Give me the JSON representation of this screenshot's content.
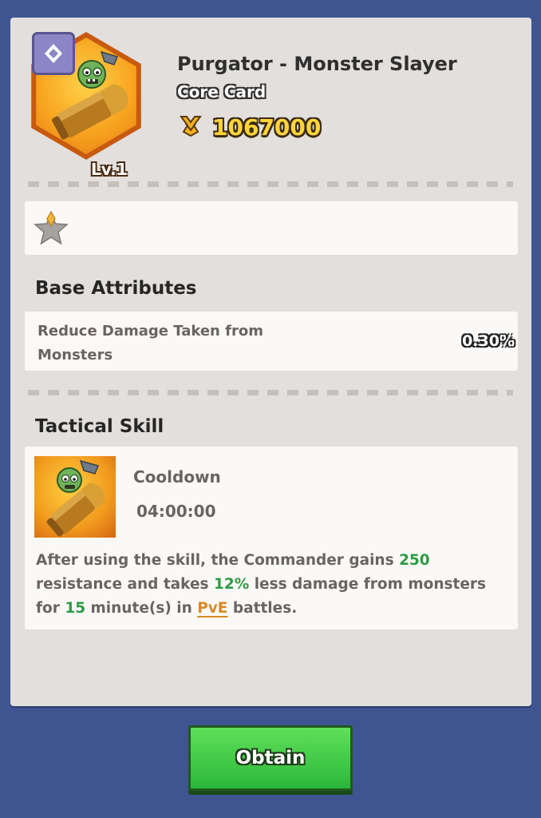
{
  "card": {
    "name": "Purgator - Monster Slayer",
    "type": "Core Card",
    "level": "Lv.1",
    "power": "1067000",
    "power_icon": "crossed-swords-shield-icon",
    "rarity_icon": "diamond-badge-icon",
    "stars": {
      "filled": 0,
      "total": 1
    }
  },
  "base_attributes": {
    "title": "Base Attributes",
    "items": [
      {
        "name": "Reduce Damage Taken from Monsters",
        "value": "0.30%"
      }
    ]
  },
  "tactical_skill": {
    "title": "Tactical Skill",
    "cooldown_label": "Cooldown",
    "cooldown_value": "04:00:00",
    "desc": {
      "p1": "After using the skill, the Commander gains ",
      "v1": "250",
      "p2": " resistance and takes ",
      "v2": "12%",
      "p3": " less damage from monsters for ",
      "v3": "15",
      "p4": " minute(s) in ",
      "link": "PvE",
      "p5": " battles."
    }
  },
  "actions": {
    "obtain_label": "Obtain"
  },
  "colors": {
    "background": "#3f5592",
    "panel": "#e2dfdc",
    "highlight_green": "#2f9a43",
    "link_orange": "#d88a26",
    "button_green": "#2cb73a",
    "power_gold": "#ffd53a"
  }
}
